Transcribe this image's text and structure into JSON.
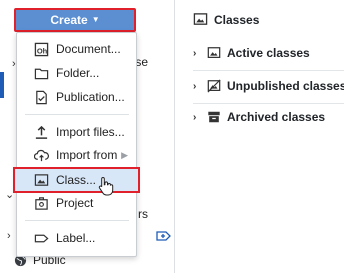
{
  "create_button": {
    "label": "Create"
  },
  "menu": {
    "items": [
      {
        "label": "Document...",
        "icon": "document-icon"
      },
      {
        "label": "Folder...",
        "icon": "folder-icon"
      },
      {
        "label": "Publication...",
        "icon": "publication-icon"
      },
      {
        "label": "Import files...",
        "icon": "upload-icon"
      },
      {
        "label": "Import from",
        "icon": "cloud-upload-icon",
        "has_submenu": true
      },
      {
        "label": "Class...",
        "icon": "class-icon",
        "highlighted": true
      },
      {
        "label": "Project",
        "icon": "project-icon"
      },
      {
        "label": "Label...",
        "icon": "label-icon"
      }
    ]
  },
  "background": {
    "partial_text_1": "rprise",
    "partial_text_2": "rs",
    "public_label": "Public"
  },
  "classes_panel": {
    "title": "Classes",
    "rows": [
      {
        "label": "Active classes"
      },
      {
        "label": "Unpublished classes"
      },
      {
        "label": "Archived classes"
      }
    ]
  },
  "colors": {
    "create_button_bg": "#5b8fd2",
    "annotation_red": "#e0202a",
    "highlight_bg": "#d8e7f8",
    "active_bar": "#1f5cb8"
  }
}
